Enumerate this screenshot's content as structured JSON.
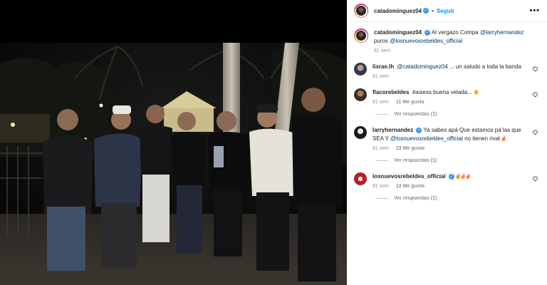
{
  "header": {
    "username": "catadominguez04",
    "dot": "•",
    "follow_label": "Seguir",
    "more_label": "•••"
  },
  "caption": {
    "username": "catadominguez04",
    "text_before": "Al vergazo Compa",
    "mention_1": "@larryhernandez",
    "text_middle": "puros",
    "mention_2": "@losnuevosrebeldes_official",
    "time": "81 sem"
  },
  "comments": [
    {
      "username": "lisrae.lh",
      "mention": "@catadominguez04",
      "text": "... un saludo a toda la banda",
      "time": "81 sem"
    },
    {
      "username": "flacorebeldes",
      "text": "#asiess buena velada...",
      "time": "81 sem",
      "likes": "11 Me gusta",
      "replies": "Ver respuestas (1)"
    },
    {
      "username": "larryhernandez",
      "text": "Ya sabes apá Que estamos pá las que SEA Y",
      "mention": "@losnuevosrebeldes_official",
      "text_after": "no tienen rival",
      "time": "81 sem",
      "likes": "23 Me gusta",
      "replies": "Ver respuestas (1)"
    },
    {
      "username": "losnuevosrebeldes_official",
      "text": "",
      "time": "81 sem",
      "likes": "12 Me gusta",
      "replies": "Ver respuestas (1)"
    }
  ],
  "icons": {
    "verified": "✓"
  },
  "colors": {
    "accent": "#0095f6",
    "verified": "#3897f0",
    "mention": "#00376b",
    "muted": "#8e8e8e"
  }
}
